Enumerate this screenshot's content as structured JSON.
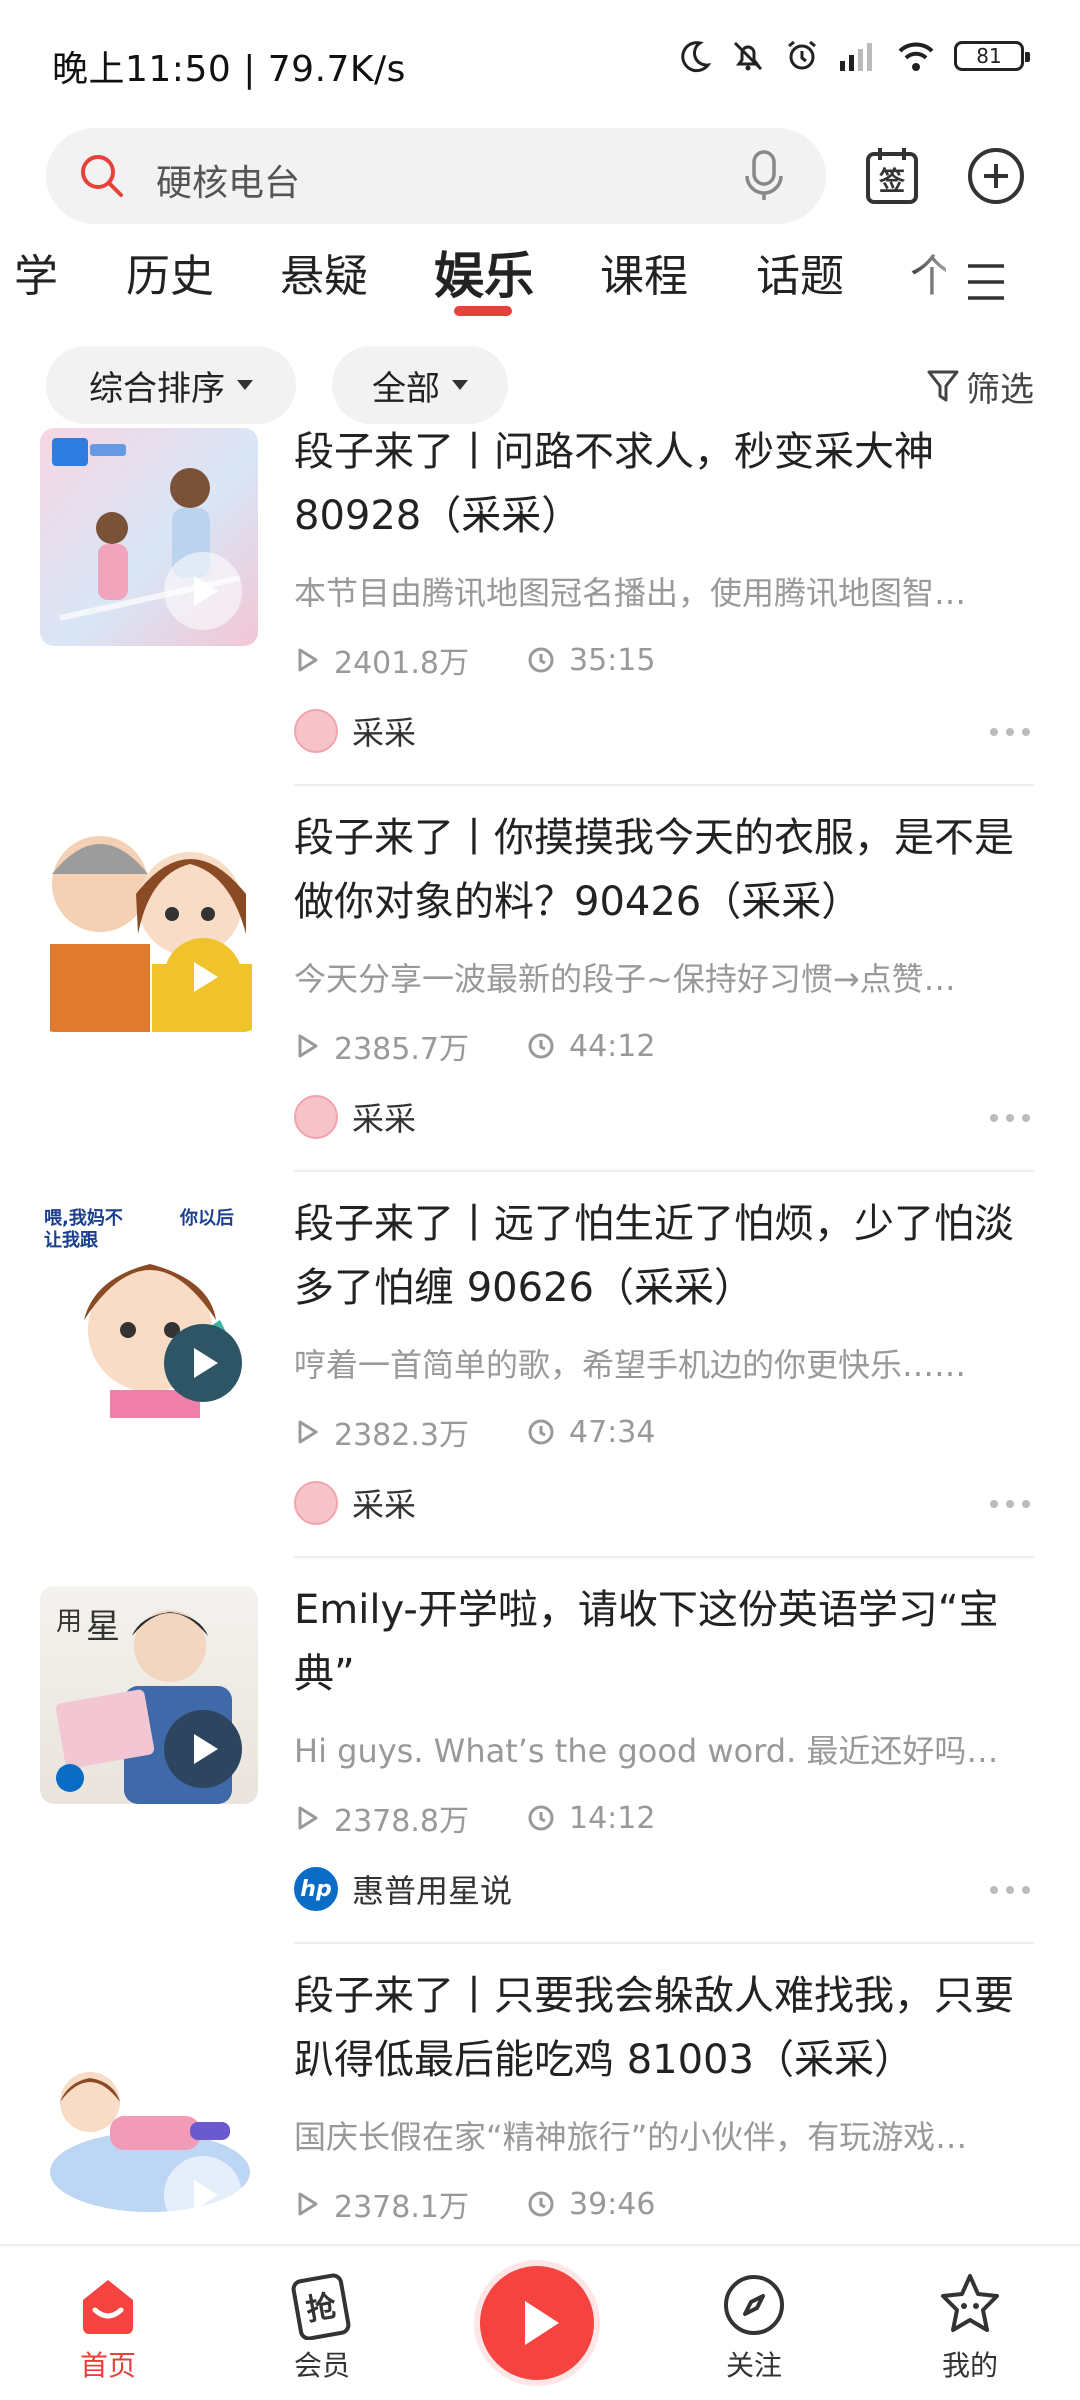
{
  "status_bar": {
    "time_speed": "晚上11:50 | 79.7K/s",
    "battery": "81"
  },
  "search": {
    "placeholder": "硬核电台"
  },
  "tabs": [
    {
      "label": "学"
    },
    {
      "label": "历史"
    },
    {
      "label": "悬疑"
    },
    {
      "label": "娱乐",
      "active": true
    },
    {
      "label": "课程"
    },
    {
      "label": "话题"
    },
    {
      "label": "个"
    }
  ],
  "filters": {
    "sort_label": "综合排序",
    "scope_label": "全部",
    "filter_label": "筛选"
  },
  "items": [
    {
      "title": "段子来了丨问路不求人，秒变采大神80928（采采）",
      "desc": "本节目由腾讯地图冠名播出，使用腾讯地图智…",
      "plays": "2401.8万",
      "duration": "35:15",
      "author": "采采"
    },
    {
      "title": "段子来了丨你摸摸我今天的衣服，是不是做你对象的料？90426（采采）",
      "desc": "今天分享一波最新的段子~保持好习惯→点赞…",
      "plays": "2385.7万",
      "duration": "44:12",
      "author": "采采"
    },
    {
      "title": "段子来了丨远了怕生近了怕烦，少了怕淡多了怕缠 90626（采采）",
      "desc": "哼着一首简单的歌，希望手机边的你更快乐……",
      "plays": "2382.3万",
      "duration": "47:34",
      "author": "采采"
    },
    {
      "title": "Emily-开学啦，请收下这份英语学习“宝典”",
      "desc": "Hi guys. What’s the good word. 最近还好吗…",
      "plays": "2378.8万",
      "duration": "14:12",
      "author": "惠普用星说"
    },
    {
      "title": "段子来了丨只要我会躲敌人难找我，只要趴得低最后能吃鸡 81003（采采）",
      "desc": "国庆长假在家“精神旅行”的小伙伴，有玩游戏…",
      "plays": "2378.1万",
      "duration": "39:46"
    }
  ],
  "bottom_nav": {
    "home": "首页",
    "vip": "会员",
    "follow": "关注",
    "mine": "我的"
  },
  "colors": {
    "accent": "#e8403b",
    "play_red": "#f5433f"
  }
}
